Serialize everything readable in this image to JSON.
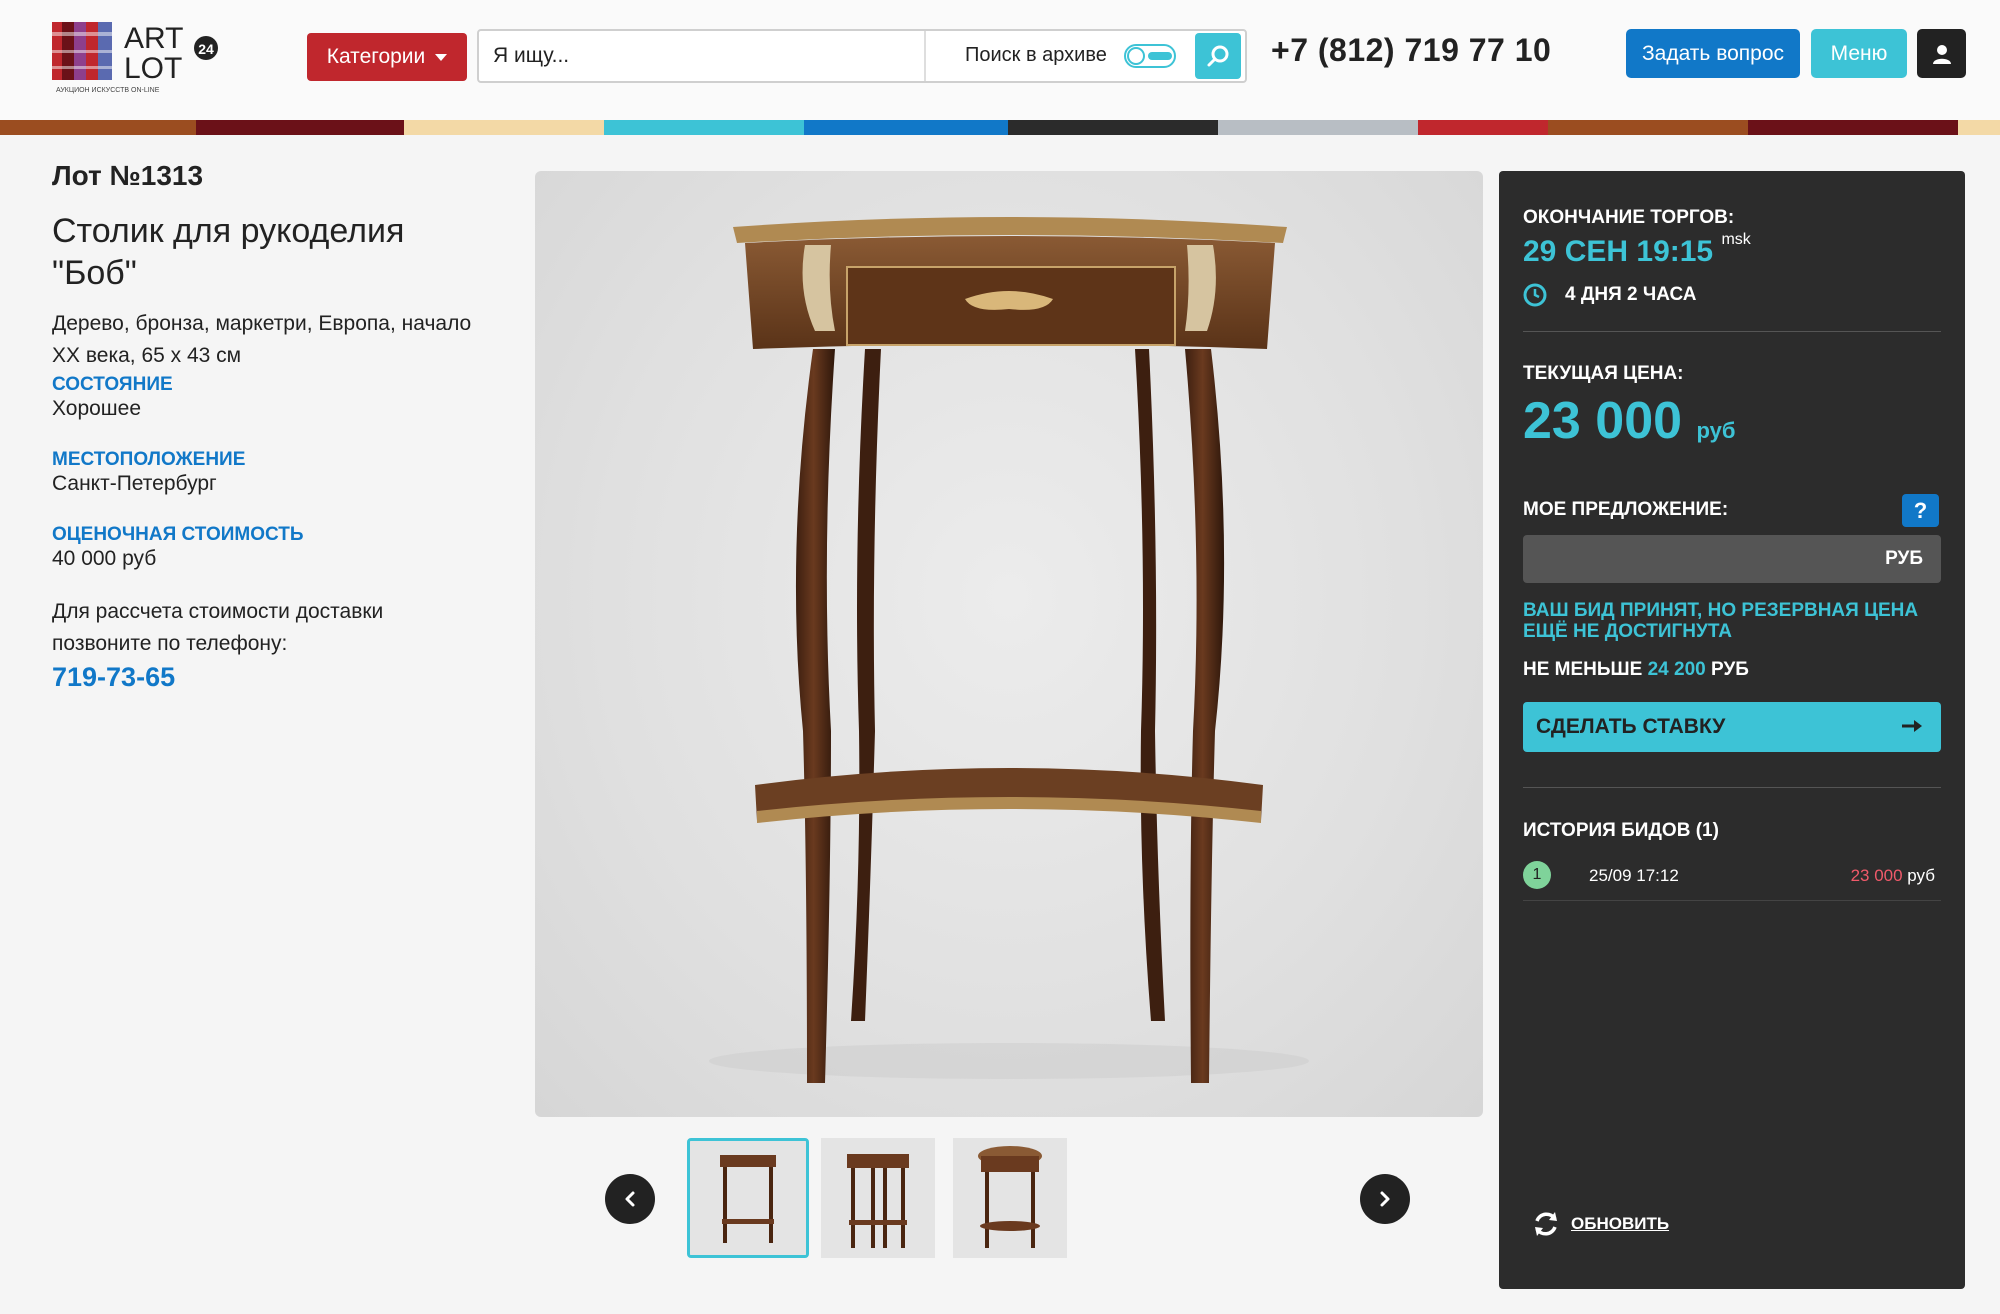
{
  "header": {
    "logo": {
      "line1": "ART",
      "line2": "LOT",
      "badge": "24",
      "tagline": "АУКЦИОН ИСКУССТВ ON-LINE"
    },
    "categories_label": "Категории",
    "search_placeholder": "Я ищу...",
    "archive_label": "Поиск в архиве",
    "archive_toggle": "on",
    "phone": "+7 (812) 719 77 10",
    "ask_label": "Задать вопрос",
    "menu_label": "Меню"
  },
  "stripe_colors": [
    "#9b4d20",
    "#6b1118",
    "#f3d9a6",
    "#3dc3d6",
    "#1178c8",
    "#2b2b2b",
    "#b8bec4",
    "#c0272d",
    "#9b4d20",
    "#6b1118",
    "#f3d9a6"
  ],
  "lot": {
    "number": "Лот №1313",
    "title": "Столик для рукоделия \"Боб\"",
    "description": "Дерево, бронза, маркетри, Европа, начало XX века, 65 х 43 см",
    "condition_label": "СОСТОЯНИЕ",
    "condition": "Хорошее",
    "location_label": "МЕСТОПОЛОЖЕНИЕ",
    "location": "Санкт-Петербург",
    "estimate_label": "ОЦЕНОЧНАЯ СТОИМОСТЬ",
    "estimate": "40 000 руб",
    "delivery_text": "Для рассчета стоимости доставки позвоните по телефону:",
    "delivery_phone": "719-73-65"
  },
  "gallery": {
    "thumb_count": 3,
    "active_thumb": 1
  },
  "auction": {
    "end_label": "ОКОНЧАНИЕ ТОРГОВ:",
    "end_date": "29 СЕН 19:15",
    "end_tz": "msk",
    "remaining": "4 ДНЯ 2 ЧАСА",
    "price_label": "ТЕКУЩАЯ ЦЕНА:",
    "price": "23 000",
    "price_currency": "руб",
    "offer_label": "МОЕ ПРЕДЛОЖЕНИЕ:",
    "help": "?",
    "offer_currency": "РУБ",
    "warning": "ВАШ БИД ПРИНЯТ, НО РЕЗЕРВНАЯ ЦЕНА ЕЩЁ НЕ ДОСТИГНУТА",
    "min_prefix": "НЕ МЕНЬШЕ",
    "min_amount": "24 200",
    "min_suffix": "РУБ",
    "bid_button": "СДЕЛАТЬ СТАВКУ",
    "history_label": "ИСТОРИЯ БИДОВ (1)",
    "history": [
      {
        "num": "1",
        "date": "25/09 17:12",
        "amount": "23 000",
        "currency": "руб"
      }
    ],
    "refresh_label": "ОБНОВИТЬ"
  }
}
